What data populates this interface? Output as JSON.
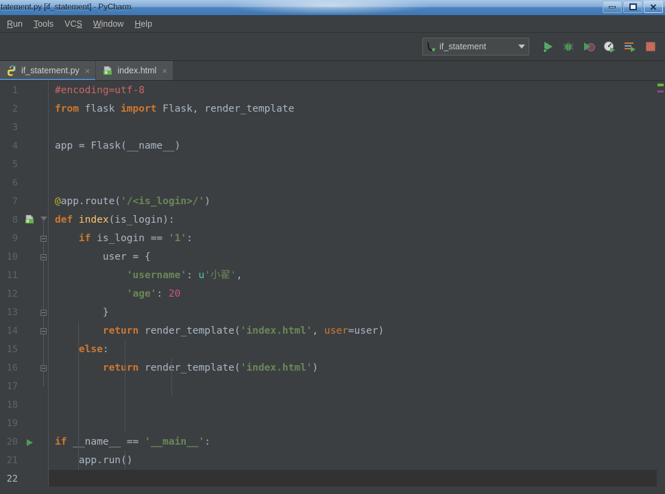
{
  "window": {
    "title": "tatement.py [if_statement] - PyCharm",
    "controls": {
      "minimize": "minimize-button",
      "maximize": "maximize-button",
      "close": "close-button"
    }
  },
  "menubar": {
    "items": [
      {
        "label": "Run",
        "mnemonic": "R",
        "rest": "un"
      },
      {
        "label": "Tools",
        "mnemonic": "T",
        "rest": "ools"
      },
      {
        "label": "VCS",
        "mnemonic": "S",
        "pre": "VC"
      },
      {
        "label": "Window",
        "mnemonic": "W",
        "rest": "indow"
      },
      {
        "label": "Help",
        "mnemonic": "H",
        "rest": "elp"
      }
    ]
  },
  "toolbar": {
    "run_configuration": "if_statement",
    "buttons": [
      {
        "name": "run-button",
        "tooltip": "Run 'if_statement'"
      },
      {
        "name": "debug-button",
        "tooltip": "Debug 'if_statement'"
      },
      {
        "name": "run-coverage-button",
        "tooltip": "Run 'if_statement' with Coverage"
      },
      {
        "name": "profile-button",
        "tooltip": "Profile 'if_statement'"
      },
      {
        "name": "run-console-button",
        "tooltip": "Run with Console"
      },
      {
        "name": "stop-button",
        "tooltip": "Stop"
      }
    ]
  },
  "tabs": [
    {
      "label": "if_statement.py",
      "icon": "python-file-icon",
      "active": true,
      "close": "×"
    },
    {
      "label": "index.html",
      "icon": "html-file-icon",
      "active": false,
      "close": "×"
    }
  ],
  "editor": {
    "current_line": 22,
    "line_numbers": [
      1,
      2,
      3,
      4,
      5,
      6,
      7,
      8,
      9,
      10,
      11,
      12,
      13,
      14,
      15,
      16,
      17,
      18,
      19,
      20,
      21,
      22
    ],
    "lines": [
      {
        "n": 1,
        "tokens": [
          {
            "t": "#encoding=utf-8",
            "c": "comment"
          }
        ]
      },
      {
        "n": 2,
        "tokens": [
          {
            "t": "from",
            "c": "keyword"
          },
          {
            "t": " flask ",
            "c": "default"
          },
          {
            "t": "import",
            "c": "keyword"
          },
          {
            "t": " Flask, render_template",
            "c": "default"
          }
        ]
      },
      {
        "n": 3,
        "tokens": []
      },
      {
        "n": 4,
        "tokens": [
          {
            "t": "app = Flask(__name__)",
            "c": "default"
          }
        ]
      },
      {
        "n": 5,
        "tokens": []
      },
      {
        "n": 6,
        "tokens": []
      },
      {
        "n": 7,
        "tokens": [
          {
            "t": "@",
            "c": "deco"
          },
          {
            "t": "app.route(",
            "c": "default"
          },
          {
            "t": "'/<is_login>/'",
            "c": "strbold"
          },
          {
            "t": ")",
            "c": "default"
          }
        ]
      },
      {
        "n": 8,
        "tokens": [
          {
            "t": "def ",
            "c": "keyword"
          },
          {
            "t": "index",
            "c": "funcname"
          },
          {
            "t": "(is_login):",
            "c": "default"
          }
        ]
      },
      {
        "n": 9,
        "tokens": [
          {
            "t": "    ",
            "c": "default"
          },
          {
            "t": "if",
            "c": "keyword"
          },
          {
            "t": " is_login == ",
            "c": "default"
          },
          {
            "t": "'1'",
            "c": "strbold"
          },
          {
            "t": ":",
            "c": "default"
          }
        ]
      },
      {
        "n": 10,
        "tokens": [
          {
            "t": "        user = {",
            "c": "default"
          }
        ]
      },
      {
        "n": 11,
        "tokens": [
          {
            "t": "            ",
            "c": "default"
          },
          {
            "t": "'username'",
            "c": "strbold"
          },
          {
            "t": ": ",
            "c": "default"
          },
          {
            "t": "u",
            "c": "uprefix"
          },
          {
            "t": "'小翟'",
            "c": "string"
          },
          {
            "t": ",",
            "c": "default"
          }
        ]
      },
      {
        "n": 12,
        "tokens": [
          {
            "t": "            ",
            "c": "default"
          },
          {
            "t": "'age'",
            "c": "strbold"
          },
          {
            "t": ": ",
            "c": "default"
          },
          {
            "t": "20",
            "c": "number"
          }
        ]
      },
      {
        "n": 13,
        "tokens": [
          {
            "t": "        }",
            "c": "default"
          }
        ]
      },
      {
        "n": 14,
        "tokens": [
          {
            "t": "        ",
            "c": "default"
          },
          {
            "t": "return",
            "c": "keyword"
          },
          {
            "t": " render_template(",
            "c": "default"
          },
          {
            "t": "'index.html'",
            "c": "strbold"
          },
          {
            "t": ", ",
            "c": "default"
          },
          {
            "t": "user",
            "c": "kwarg"
          },
          {
            "t": "=user)",
            "c": "default"
          }
        ]
      },
      {
        "n": 15,
        "tokens": [
          {
            "t": "    ",
            "c": "default"
          },
          {
            "t": "else",
            "c": "keyword"
          },
          {
            "t": ":",
            "c": "default"
          }
        ]
      },
      {
        "n": 16,
        "tokens": [
          {
            "t": "        ",
            "c": "default"
          },
          {
            "t": "return",
            "c": "keyword"
          },
          {
            "t": " render_template(",
            "c": "default"
          },
          {
            "t": "'index.html'",
            "c": "strbold"
          },
          {
            "t": ")",
            "c": "default"
          }
        ]
      },
      {
        "n": 17,
        "tokens": []
      },
      {
        "n": 18,
        "tokens": []
      },
      {
        "n": 19,
        "tokens": []
      },
      {
        "n": 20,
        "tokens": [
          {
            "t": "if",
            "c": "keyword"
          },
          {
            "t": " __name__ == ",
            "c": "default"
          },
          {
            "t": "'__main__'",
            "c": "strbold"
          },
          {
            "t": ":",
            "c": "default"
          }
        ]
      },
      {
        "n": 21,
        "tokens": [
          {
            "t": "    app.run()",
            "c": "default"
          }
        ]
      },
      {
        "n": 22,
        "tokens": []
      }
    ],
    "gutter_icons": [
      {
        "line": 8,
        "name": "html-template-gutter-icon"
      },
      {
        "line": 20,
        "name": "run-gutter-icon"
      }
    ],
    "fold_markers": [
      9,
      10,
      13,
      14,
      16
    ],
    "fold_arrows": [
      8
    ]
  },
  "colors": {
    "editor_bg": "#3c3f41",
    "current_line_bg": "#323232",
    "comment": "#cc6666",
    "keyword": "#cc7832",
    "string": "#6a8759",
    "number": "#cc5191",
    "decorator": "#bbb529",
    "function": "#ffc66d",
    "default_text": "#a9b7c6",
    "accent_tab": "#4a88c7",
    "run_green": "#59a869",
    "stop_red": "#c75450"
  }
}
